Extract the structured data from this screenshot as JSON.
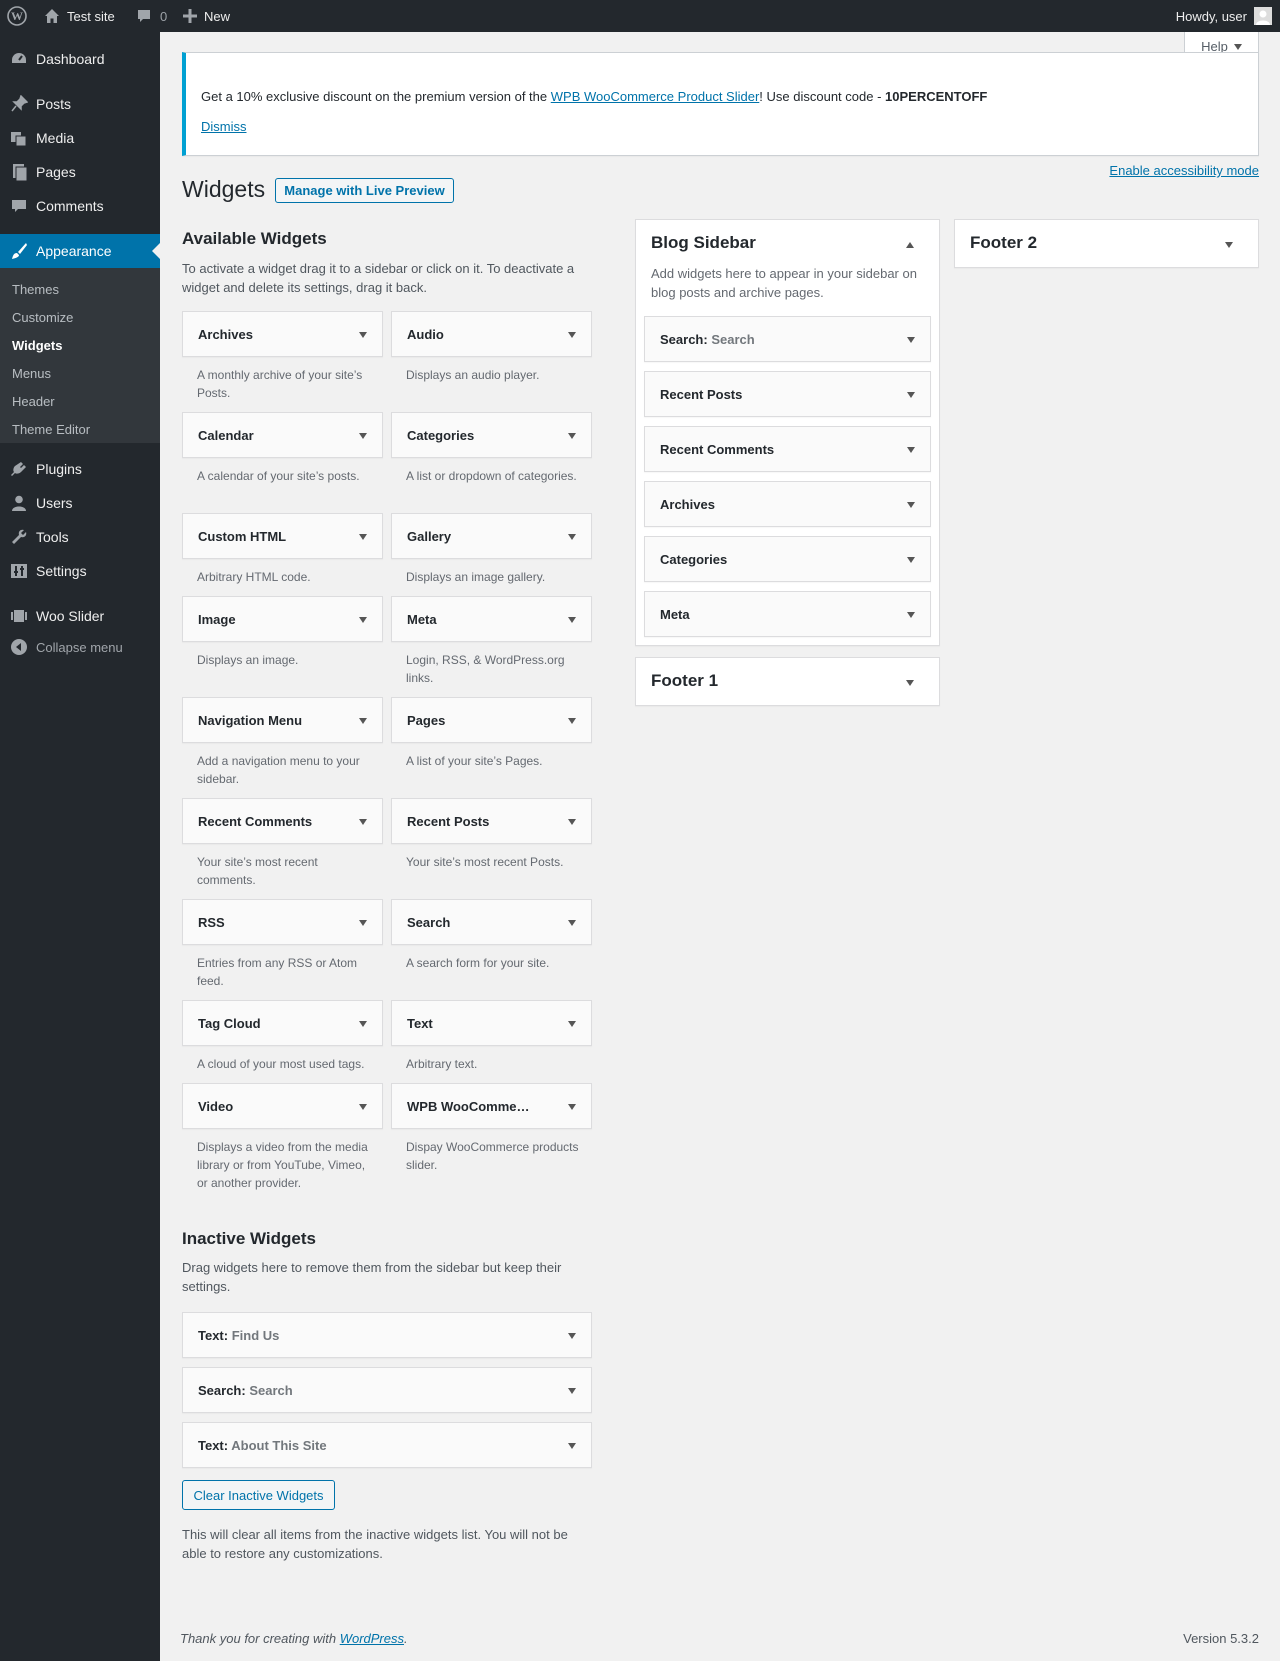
{
  "admin_bar": {
    "site_name": "Test site",
    "comments_count": "0",
    "new_label": "New",
    "howdy": "Howdy, user"
  },
  "menu": {
    "dashboard": "Dashboard",
    "posts": "Posts",
    "media": "Media",
    "pages": "Pages",
    "comments": "Comments",
    "appearance": "Appearance",
    "themes": "Themes",
    "customize": "Customize",
    "widgets": "Widgets",
    "menus": "Menus",
    "header": "Header",
    "theme_editor": "Theme Editor",
    "plugins": "Plugins",
    "users": "Users",
    "tools": "Tools",
    "settings": "Settings",
    "woo_slider": "Woo Slider",
    "collapse": "Collapse menu"
  },
  "help_label": "Help",
  "notice": {
    "text_before": "Get a 10% exclusive discount on the premium version of the ",
    "link": "WPB WooCommerce Product Slider",
    "text_after": "! Use discount code - ",
    "code": "10PERCENTOFF",
    "dismiss": "Dismiss"
  },
  "accessibility_link": "Enable accessibility mode",
  "page_title": "Widgets",
  "live_preview_button": "Manage with Live Preview",
  "available": {
    "heading": "Available Widgets",
    "description": "To activate a widget drag it to a sidebar or click on it. To deactivate a widget and delete its settings, drag it back.",
    "widgets": [
      {
        "title": "Archives",
        "desc": "A monthly archive of your site’s Posts."
      },
      {
        "title": "Audio",
        "desc": "Displays an audio player."
      },
      {
        "title": "Calendar",
        "desc": "A calendar of your site’s posts."
      },
      {
        "title": "Categories",
        "desc": "A list or dropdown of categories."
      },
      {
        "title": "Custom HTML",
        "desc": "Arbitrary HTML code."
      },
      {
        "title": "Gallery",
        "desc": "Displays an image gallery."
      },
      {
        "title": "Image",
        "desc": "Displays an image."
      },
      {
        "title": "Meta",
        "desc": "Login, RSS, & WordPress.org links."
      },
      {
        "title": "Navigation Menu",
        "desc": "Add a navigation menu to your sidebar."
      },
      {
        "title": "Pages",
        "desc": "A list of your site’s Pages."
      },
      {
        "title": "Recent Comments",
        "desc": "Your site’s most recent comments."
      },
      {
        "title": "Recent Posts",
        "desc": "Your site’s most recent Posts."
      },
      {
        "title": "RSS",
        "desc": "Entries from any RSS or Atom feed."
      },
      {
        "title": "Search",
        "desc": "A search form for your site."
      },
      {
        "title": "Tag Cloud",
        "desc": "A cloud of your most used tags."
      },
      {
        "title": "Text",
        "desc": "Arbitrary text."
      },
      {
        "title": "Video",
        "desc": "Displays a video from the media library or from YouTube, Vimeo, or another provider."
      },
      {
        "title": "WPB WooComme…",
        "desc": "Dispay WooCommerce products slider."
      }
    ]
  },
  "blog_sidebar": {
    "title": "Blog Sidebar",
    "description": "Add widgets here to appear in your sidebar on blog posts and archive pages.",
    "widgets": [
      {
        "title": "Search:",
        "sub": "Search"
      },
      {
        "title": "Recent Posts",
        "sub": ""
      },
      {
        "title": "Recent Comments",
        "sub": ""
      },
      {
        "title": "Archives",
        "sub": ""
      },
      {
        "title": "Categories",
        "sub": ""
      },
      {
        "title": "Meta",
        "sub": ""
      }
    ]
  },
  "footer1": {
    "title": "Footer 1"
  },
  "footer2": {
    "title": "Footer 2"
  },
  "inactive": {
    "heading": "Inactive Widgets",
    "description": "Drag widgets here to remove them from the sidebar but keep their settings.",
    "widgets": [
      {
        "title": "Text:",
        "sub": "Find Us"
      },
      {
        "title": "Search:",
        "sub": "Search"
      },
      {
        "title": "Text:",
        "sub": "About This Site"
      }
    ],
    "clear_button": "Clear Inactive Widgets",
    "clear_note": "This will clear all items from the inactive widgets list. You will not be able to restore any customizations."
  },
  "footer": {
    "thanks": "Thank you for creating with ",
    "wp_link": "WordPress",
    "period": ".",
    "version": "Version 5.3.2"
  },
  "colors": {
    "admin_dark": "#23282d",
    "accent": "#0073aa",
    "submenu": "#32373c"
  }
}
